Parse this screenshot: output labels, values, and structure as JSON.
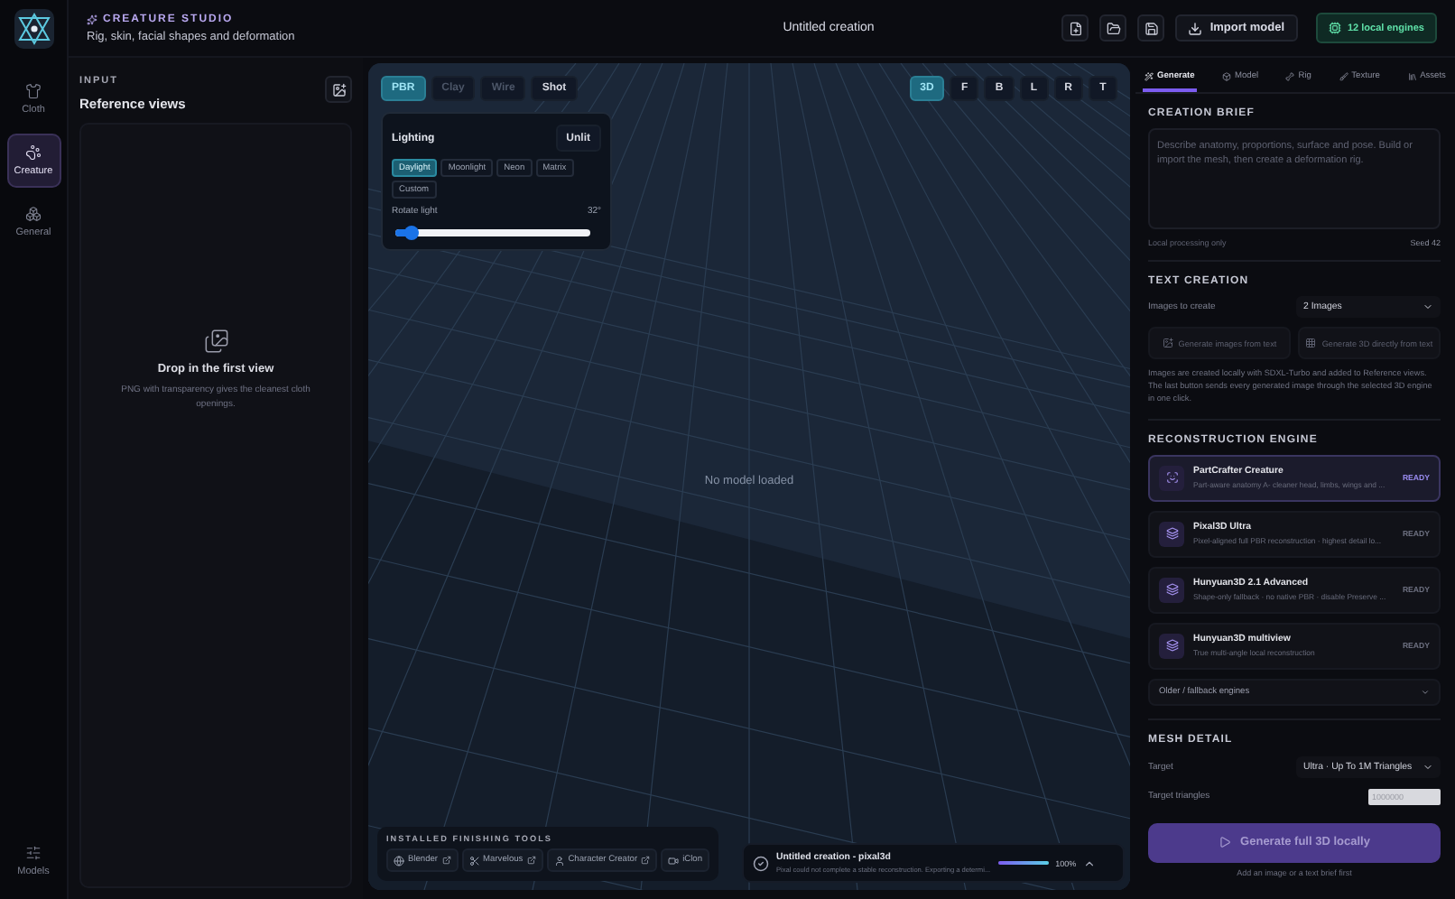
{
  "app": {
    "section": "CREATURE STUDIO",
    "subtitle": "Rig, skin, facial shapes and deformation",
    "document_title": "Untitled creation",
    "import_button": "Import model",
    "engines_badge": "12 local engines"
  },
  "nav": [
    {
      "label": "Cloth",
      "selected": false
    },
    {
      "label": "Creature",
      "selected": true
    },
    {
      "label": "General",
      "selected": false
    }
  ],
  "nav_bottom": {
    "label": "Models"
  },
  "input_panel": {
    "eyebrow": "INPUT",
    "title": "Reference views",
    "drop_title": "Drop in the first view",
    "drop_hint": "PNG with transparency gives the cleanest cloth openings."
  },
  "viewport": {
    "shading_modes": [
      {
        "label": "PBR",
        "selected": true,
        "disabled": false
      },
      {
        "label": "Clay",
        "selected": false,
        "disabled": true
      },
      {
        "label": "Wire",
        "selected": false,
        "disabled": true
      },
      {
        "label": "Shot",
        "selected": false,
        "disabled": false
      }
    ],
    "views": [
      {
        "label": "3D",
        "selected": true
      },
      {
        "label": "F",
        "selected": false
      },
      {
        "label": "B",
        "selected": false
      },
      {
        "label": "L",
        "selected": false
      },
      {
        "label": "R",
        "selected": false
      },
      {
        "label": "T",
        "selected": false
      }
    ],
    "lighting": {
      "title": "Lighting",
      "unlit_button": "Unlit",
      "presets": [
        {
          "label": "Daylight",
          "selected": true
        },
        {
          "label": "Moonlight",
          "selected": false
        },
        {
          "label": "Neon",
          "selected": false
        },
        {
          "label": "Matrix",
          "selected": false
        },
        {
          "label": "Custom",
          "selected": false
        }
      ],
      "rotate_label": "Rotate light",
      "reading": "32°",
      "level": 0.08
    },
    "empty_text": "No model loaded",
    "tools": {
      "heading": "INSTALLED FINISHING TOOLS",
      "items": [
        {
          "label": "Blender",
          "external": true
        },
        {
          "label": "Marvelous",
          "external": true
        },
        {
          "label": "Character Creator",
          "external": true
        },
        {
          "label": "iClon",
          "external": false
        }
      ]
    },
    "job": {
      "title": "Untitled creation - pixal3d",
      "message": "Pixal could not complete a stable reconstruction. Exporting a determi...",
      "level": 1.0,
      "reading": "100%"
    }
  },
  "right_panel": {
    "tabs": [
      {
        "label": "Generate",
        "selected": true
      },
      {
        "label": "Model",
        "selected": false
      },
      {
        "label": "Rig",
        "selected": false
      },
      {
        "label": "Texture",
        "selected": false
      },
      {
        "label": "Assets",
        "selected": false
      }
    ],
    "brief": {
      "heading": "CREATION BRIEF",
      "placeholder": "Describe anatomy, proportions, surface and pose. Build or import the mesh, then create a deformation rig.",
      "footer_left": "Local processing only",
      "footer_right": "Seed 42"
    },
    "text_creation": {
      "heading": "TEXT CREATION",
      "images_label": "Images to create",
      "images_value": "2 Images",
      "buttons": [
        "Generate images from text",
        "Generate 3D directly from text"
      ],
      "note": "Images are created locally with SDXL-Turbo and added to Reference views. The last button sends every generated image through the selected 3D engine in one click."
    },
    "reconstruction": {
      "heading": "RECONSTRUCTION ENGINE",
      "engines": [
        {
          "name": "PartCrafter Creature",
          "description": "Part-aware anatomy A- cleaner head, limbs, wings and ...",
          "status": "READY",
          "selected": true
        },
        {
          "name": "Pixal3D Ultra",
          "description": "Pixel-aligned full PBR reconstruction · highest detail lo...",
          "status": "READY",
          "selected": false
        },
        {
          "name": "Hunyuan3D 2.1 Advanced",
          "description": "Shape-only fallback · no native PBR · disable Preserve ...",
          "status": "READY",
          "selected": false
        },
        {
          "name": "Hunyuan3D multiview",
          "description": "True multi-angle local reconstruction",
          "status": "READY",
          "selected": false
        }
      ],
      "fallback": "Older / fallback engines"
    },
    "mesh_detail": {
      "heading": "MESH DETAIL",
      "target_label": "Target",
      "target_value": "Ultra · Up To 1M Triangles",
      "triangles_label": "Target triangles",
      "triangles_value": "1000000",
      "triangles_disabled": true
    },
    "generate_button": {
      "label": "Generate full 3D locally",
      "disabled": true
    },
    "generate_hint": "Add an image or a text brief first"
  }
}
